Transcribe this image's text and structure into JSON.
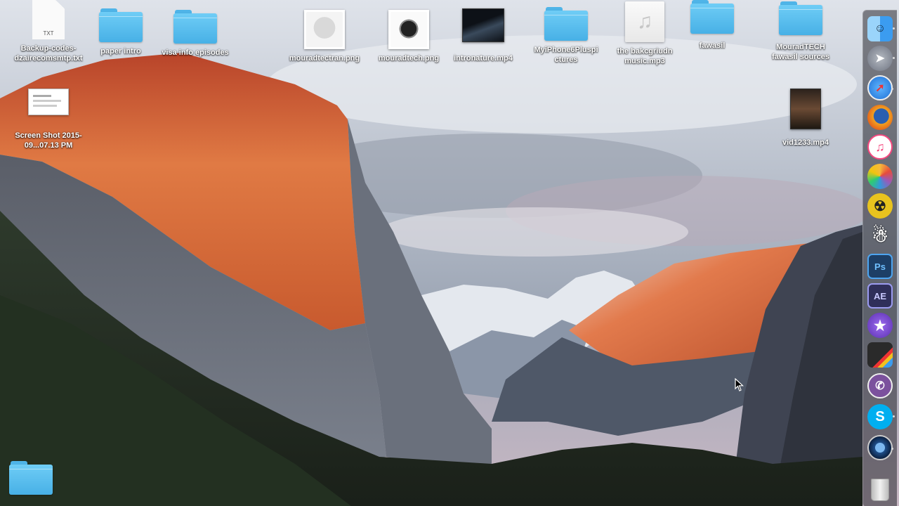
{
  "desktop": {
    "icons": [
      {
        "name": "Backup-codes-dzairecomsmtp.txt",
        "type": "text-document",
        "ext": "TXT"
      },
      {
        "name": "paper intro",
        "type": "folder"
      },
      {
        "name": "visa info episodes",
        "type": "folder"
      },
      {
        "name": "mouradtectran.png",
        "type": "image"
      },
      {
        "name": "mouradtech.png",
        "type": "image"
      },
      {
        "name": "intronature.mp4",
        "type": "video"
      },
      {
        "name": "MyiPhone6Pluspictures",
        "type": "folder"
      },
      {
        "name": "the bakcgriudn music.mp3",
        "type": "audio"
      },
      {
        "name": "fawasil",
        "type": "folder"
      },
      {
        "name": "MouradTECH fawasil sources",
        "type": "folder"
      },
      {
        "name": "Screen Shot 2015-09...07.13 PM",
        "type": "screenshot"
      },
      {
        "name": "vid1233.mp4",
        "type": "video"
      },
      {
        "name": "",
        "type": "folder"
      }
    ]
  },
  "dock": {
    "items": [
      {
        "icon": "finder-icon",
        "color": "#3b9cf0",
        "running": true
      },
      {
        "icon": "launchpad-rocket-icon",
        "color": "#8a8f98",
        "running": true
      },
      {
        "icon": "safari-compass-icon",
        "color": "#1e88e5",
        "running": true
      },
      {
        "icon": "firefox-icon",
        "color": "#e8641c",
        "running": false
      },
      {
        "icon": "itunes-note-icon",
        "color": "#f5487f",
        "running": false
      },
      {
        "icon": "photos-flower-icon",
        "color": "#f6b93b",
        "running": false
      },
      {
        "icon": "radiation-app-icon",
        "color": "#e8c31e",
        "running": false
      },
      {
        "icon": "character-app-icon",
        "color": "#ffffff",
        "running": false
      },
      {
        "icon": "photoshop-icon",
        "color": "#2b6fb5",
        "text": "Ps",
        "running": false
      },
      {
        "icon": "after-effects-icon",
        "color": "#3b3d6b",
        "text": "AE",
        "running": false
      },
      {
        "icon": "imovie-star-icon",
        "color": "#6b3fc4",
        "running": false
      },
      {
        "icon": "final-cut-icon",
        "color": "#2a2a2a",
        "running": false
      },
      {
        "icon": "viber-icon",
        "color": "#7b519d",
        "running": false
      },
      {
        "icon": "skype-icon",
        "color": "#00aff0",
        "text": "S",
        "running": true
      },
      {
        "icon": "quicktime-icon",
        "color": "#1f4f8a",
        "running": true
      },
      {
        "icon": "trash-icon",
        "color": "#d8d8d8",
        "running": false
      }
    ]
  }
}
